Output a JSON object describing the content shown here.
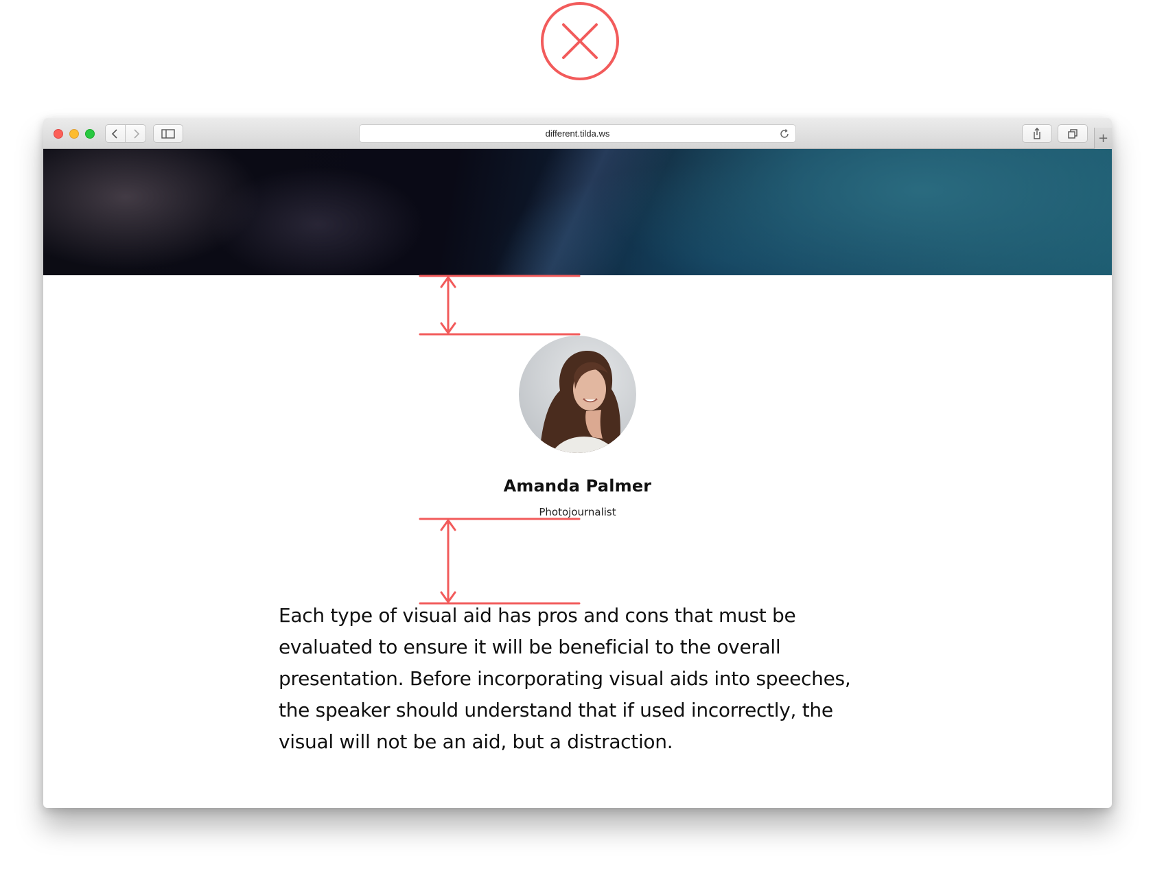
{
  "badge": {
    "icon": "x-circle-icon",
    "color": "#f25b5b"
  },
  "browser": {
    "url": "different.tilda.ws",
    "icons": {
      "back": "chevron-left-icon",
      "forward": "chevron-right-icon",
      "sidebar": "sidebar-icon",
      "reload": "reload-icon",
      "share": "share-icon",
      "tabs": "tabs-icon",
      "new_tab": "+"
    }
  },
  "profile": {
    "name": "Amanda Palmer",
    "role": "Photojournalist"
  },
  "body_text": "Each type of visual aid has pros and cons that must be evaluated to ensure it will be beneficial to the overall presentation. Before incorporating visual aids into speeches, the speaker should understand that if used incorrectly, the visual will not be an aid, but a distraction.",
  "colors": {
    "annotation": "#f25b5b",
    "text": "#111111"
  }
}
